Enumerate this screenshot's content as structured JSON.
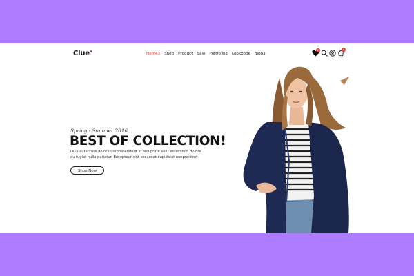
{
  "header": {
    "logo": "Clue",
    "nav": [
      "Home3",
      "Shop",
      "Product",
      "Sale",
      "Portfolio3",
      "Lookbook",
      "Blog3"
    ],
    "wishlist_count": "0",
    "cart_count": "0"
  },
  "hero": {
    "subtitle": "Spring - Summer 2016",
    "title": "BEST OF COLLECTION!",
    "description_line1": "Duis aute irure dolor in reprehenderit in voluptate velit essecillum dolore",
    "description_line2": "eu fugiat nulla pariatur. Excepteur sint occaecat cupidatat nonproident",
    "button": "Shop Now"
  },
  "colors": {
    "frame_background": "#ad7bff",
    "accent": "#e53935",
    "text": "#111111"
  },
  "icons": [
    "heart-icon",
    "search-icon",
    "user-icon",
    "cart-icon"
  ]
}
